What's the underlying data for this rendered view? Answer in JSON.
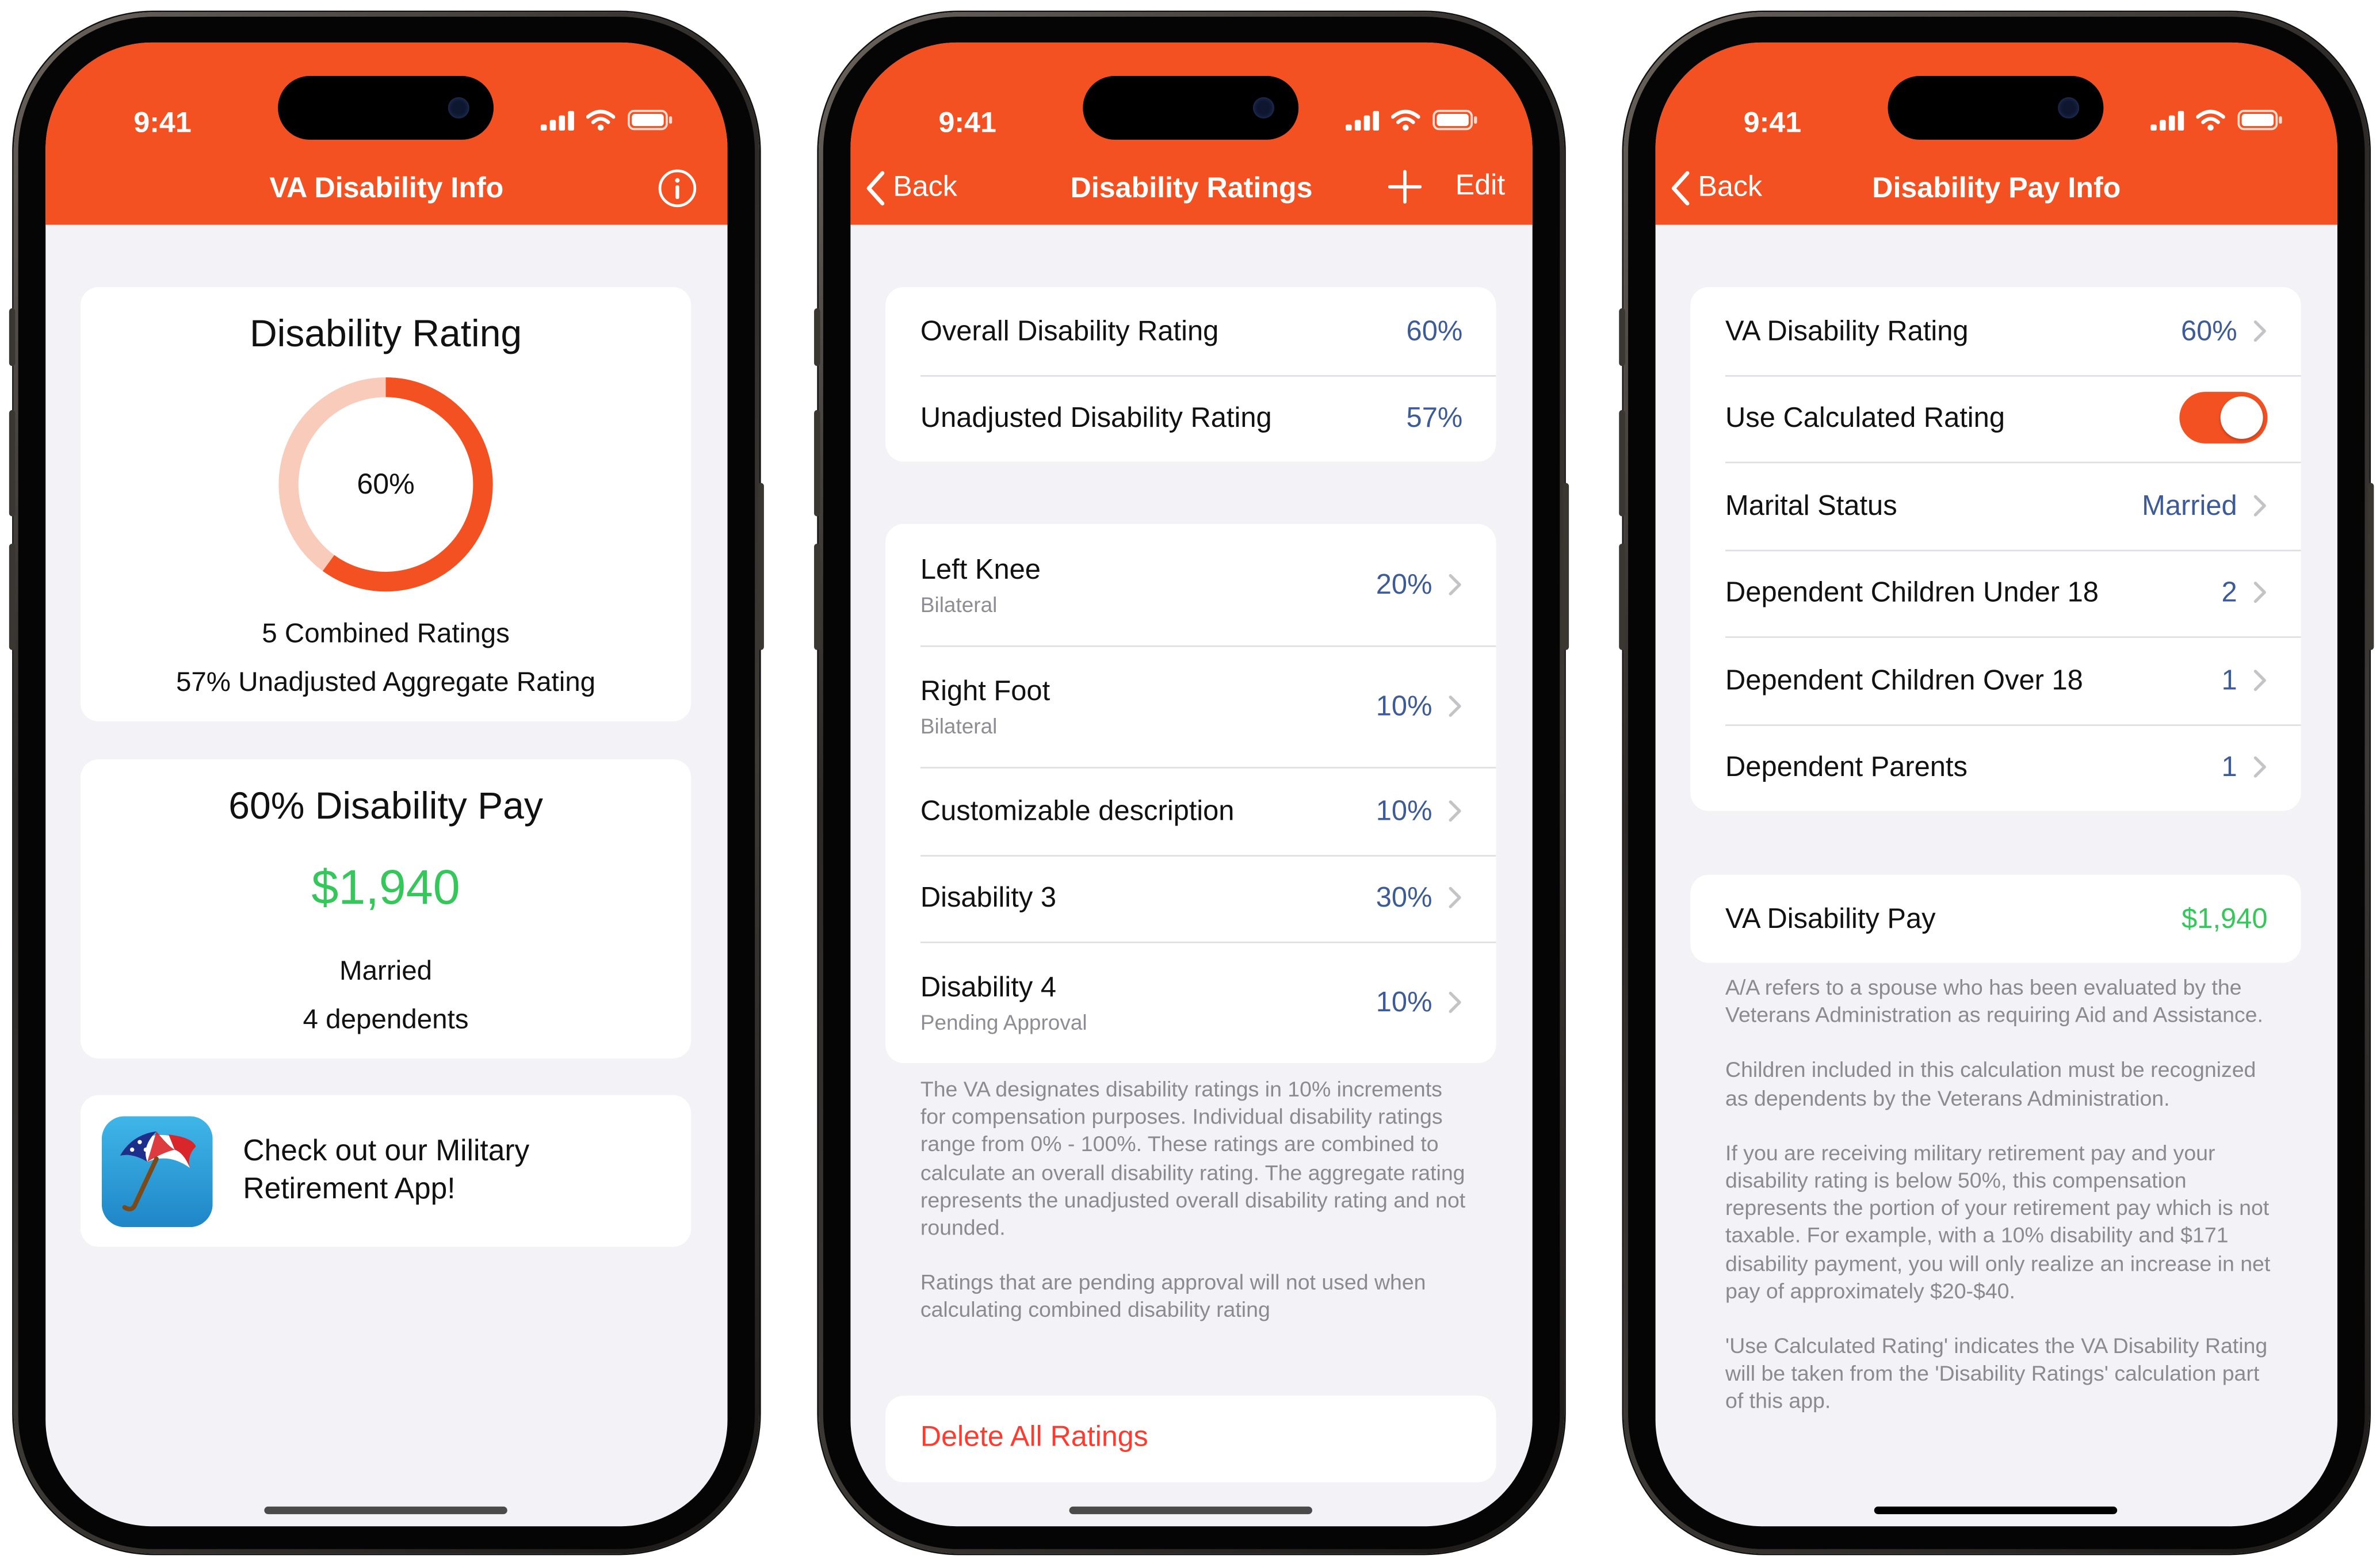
{
  "status": {
    "time": "9:41"
  },
  "screen1": {
    "nav_title": "VA Disability Info",
    "rating_card": {
      "title": "Disability Rating",
      "percent_label": "60%",
      "ring_fraction": 0.6,
      "combined": "5 Combined Ratings",
      "aggregate": "57% Unadjusted Aggregate Rating"
    },
    "pay_card": {
      "title": "60% Disability Pay",
      "amount": "$1,940",
      "marital": "Married",
      "dependents": "4 dependents"
    },
    "promo": {
      "text_line1": "Check out our Military",
      "text_line2": "Retirement App!"
    }
  },
  "screen2": {
    "back": "Back",
    "nav_title": "Disability Ratings",
    "edit": "Edit",
    "summary": [
      {
        "label": "Overall Disability Rating",
        "value": "60%"
      },
      {
        "label": "Unadjusted Disability Rating",
        "value": "57%"
      }
    ],
    "ratings": [
      {
        "label": "Left Knee",
        "sub": "Bilateral",
        "value": "20%"
      },
      {
        "label": "Right Foot",
        "sub": "Bilateral",
        "value": "10%"
      },
      {
        "label": "Customizable description",
        "sub": "",
        "value": "10%"
      },
      {
        "label": "Disability 3",
        "sub": "",
        "value": "30%"
      },
      {
        "label": "Disability 4",
        "sub": "Pending Approval",
        "value": "10%"
      }
    ],
    "footer_p1": "The VA designates disability ratings in 10% increments for compensation purposes. Individual disability ratings range from 0% - 100%. These ratings are combined to calculate an overall disability rating. The aggregate rating represents the unadjusted overall disability rating and not rounded.",
    "footer_p2": "Ratings that are pending approval will not used when calculating combined disability rating",
    "delete_label": "Delete All Ratings"
  },
  "screen3": {
    "back": "Back",
    "nav_title": "Disability Pay Info",
    "rows": [
      {
        "label": "VA Disability Rating",
        "value": "60%"
      },
      {
        "label": "Use Calculated Rating",
        "toggle": true
      },
      {
        "label": "Marital Status",
        "value": "Married"
      },
      {
        "label": "Dependent Children Under 18",
        "value": "2"
      },
      {
        "label": "Dependent Children Over 18",
        "value": "1"
      },
      {
        "label": "Dependent Parents",
        "value": "1"
      }
    ],
    "pay": {
      "label": "VA Disability Pay",
      "value": "$1,940"
    },
    "footer": [
      "A/A refers to a spouse who has been evaluated by the Veterans Administration as requiring Aid and Assistance.",
      "Children included in this calculation must be recognized as dependents by the Veterans Administration.",
      "If you are receiving military retirement pay and your disability rating is below 50%, this compensation represents the portion of your retirement pay which is not taxable. For example, with a 10% disability and $171 disability payment, you will only realize an increase in net pay of approximately $20-$40.",
      "'Use Calculated Rating' indicates the VA Disability Rating will be taken from the 'Disability Ratings' calculation part of this app."
    ]
  },
  "colors": {
    "accent": "#f45122",
    "value_blue": "#3d5a99",
    "money_green": "#34c759",
    "destructive": "#ff3b30"
  }
}
